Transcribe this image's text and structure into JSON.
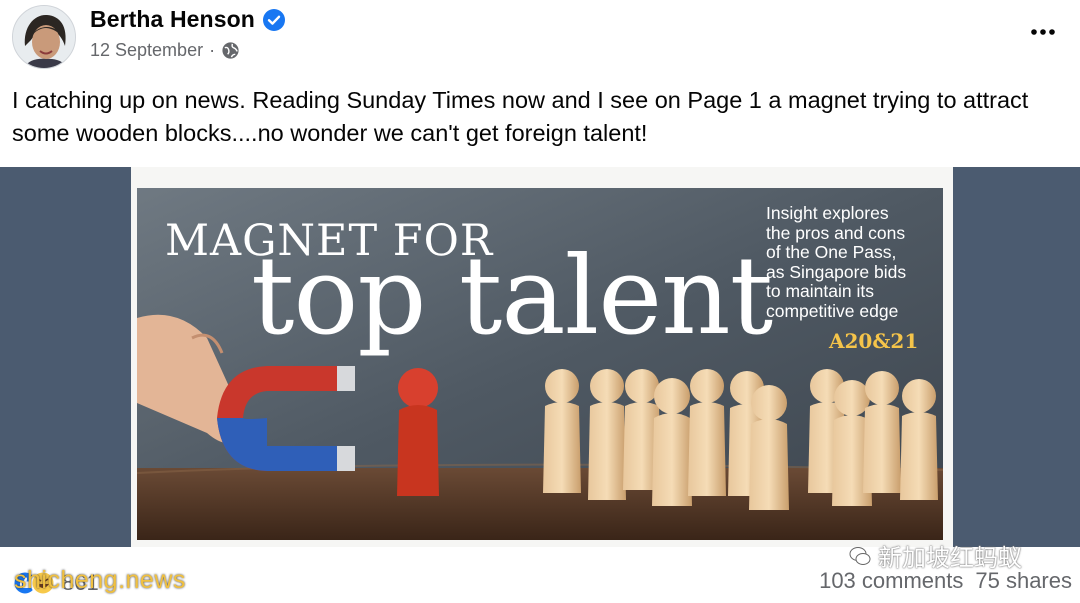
{
  "post": {
    "author": "Bertha Henson",
    "date": "12 September",
    "separator": "·",
    "text": "I catching up on news. Reading Sunday Times now and I see on Page 1 a magnet trying to attract some wooden blocks....no wonder we can't get foreign talent!"
  },
  "icons": {
    "verified": "verified-badge-icon",
    "audience": "globe-icon",
    "more": "more-options-icon",
    "reactions": [
      "like-icon",
      "haha-icon"
    ]
  },
  "colors": {
    "verified": "#1877f2",
    "secondary_text": "#65676b",
    "band": "#4b5b70",
    "page_ref": "#f5c44a"
  },
  "newspaper": {
    "headline_small": "MAGNET FOR",
    "headline_big": "top talent",
    "insight_lines": [
      "Insight explores",
      "the pros and cons",
      "of the One Pass,",
      "as Singapore bids",
      "to maintain its",
      "competitive edge"
    ],
    "page_ref": "A20&21"
  },
  "overlays": {
    "wechat_watermark": "新加坡红蚂蚁",
    "site_watermark": "shicheng.news"
  },
  "footer": {
    "reaction_count": "861",
    "comments": "103 comments",
    "shares": "75 shares"
  }
}
